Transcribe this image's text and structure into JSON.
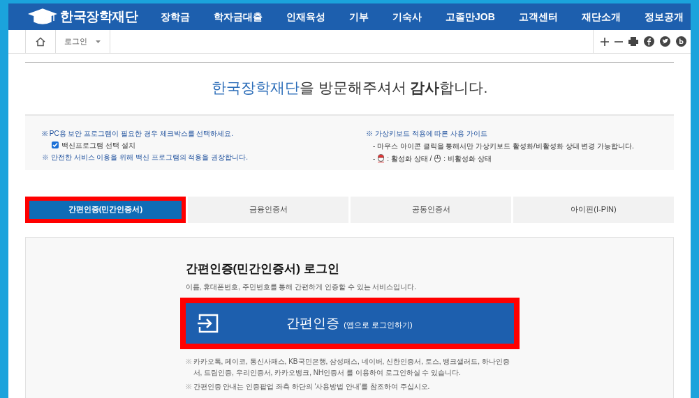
{
  "header": {
    "logo_text": "한국장학재단",
    "nav": [
      "장학금",
      "학자금대출",
      "인재육성",
      "기부",
      "기숙사",
      "고졸만JOB",
      "고객센터",
      "재단소개",
      "정보공개"
    ]
  },
  "toolbar": {
    "breadcrumb": "로그인"
  },
  "welcome": {
    "org": "한국장학재단",
    "text": "을 방문해주셔서 **감사**합니다."
  },
  "notice_left": {
    "line1": "※ PC용 보안 프로그램이 필요한 경우 체크박스를 선택하세요.",
    "checkbox": {
      "label": "백신프로그램 선택 설치",
      "checked": true
    },
    "line2": "※ 안전한 서비스 이용을 위해 백신 프로그램의 적용을 권장합니다."
  },
  "notice_right": {
    "title": "※ 가상키보드 적용에 따른 사용 가이드",
    "line1": "- 마우스 아이콘 클릭을 통해서만 가상키보드 활성화/비활성화 상태 변경 가능합니다.",
    "dash": "-",
    "active_label": ": 활성화 상태 /",
    "inactive_label": ": 비활성화 상태"
  },
  "tabs": [
    {
      "label": "간편인증(민간인증서)",
      "selected": true,
      "highlighted": true
    },
    {
      "label": "금융인증서",
      "selected": false,
      "highlighted": false
    },
    {
      "label": "공동인증서",
      "selected": false,
      "highlighted": false
    },
    {
      "label": "아이핀(I-PIN)",
      "selected": false,
      "highlighted": false
    }
  ],
  "login": {
    "title": "간편인증(민간인증서) 로그인",
    "description": "이름, 휴대폰번호, 주민번호를 통해 간편하게 인증할 수 있는 서비스입니다.",
    "button": {
      "label": "간편인증",
      "sub": "(앱으로 로그인하기)",
      "highlighted": true
    },
    "notes": [
      {
        "mark": "※",
        "text": "카카오톡, 페이코, 통신사패스, KB국민은행, 삼성패스, 네이버, 신한인증서, 토스, 뱅크샐러드, 하나인증서, 드림인증, 우리인증서, 카카오뱅크, NH인증서 를 이용하여 로그인하실 수 있습니다."
      },
      {
        "mark": "※",
        "text": "간편인증 안내는 인증팝업 좌측 하단의 '사용방법 안내'를 참조하여 주십시오."
      }
    ]
  }
}
